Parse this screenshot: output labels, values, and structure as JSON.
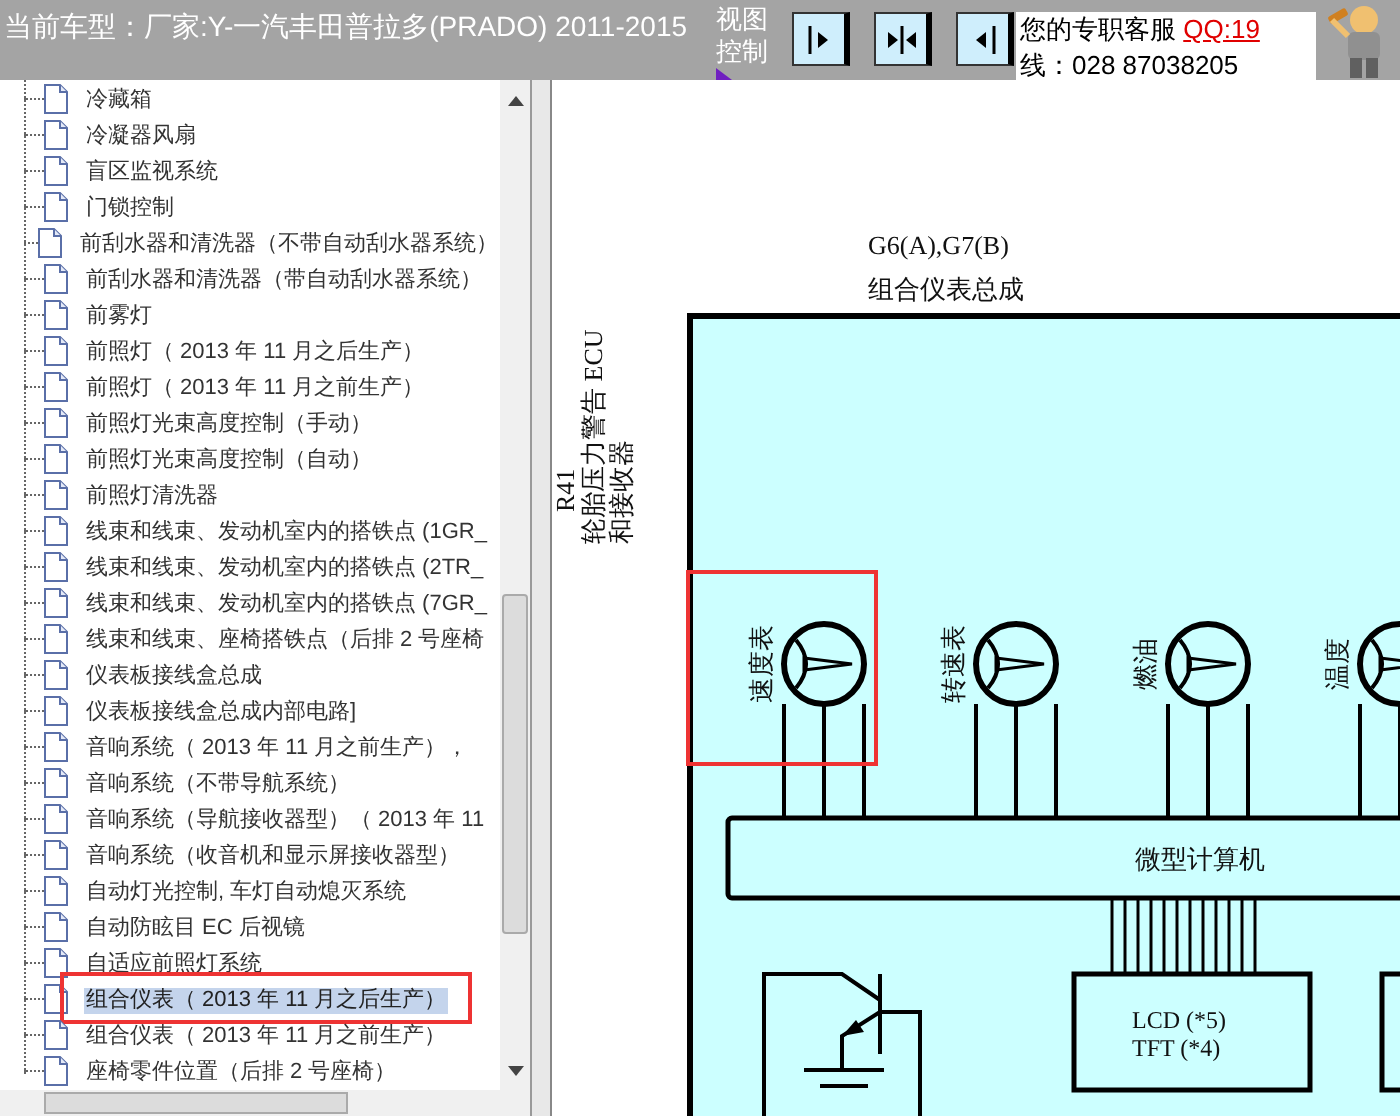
{
  "header": {
    "car_model": "当前车型：厂家:Y-一汽丰田普拉多(PRADO) 2011-2015",
    "view_control": [
      "视图",
      "控制"
    ],
    "service": {
      "label": "您的专职客服",
      "qq": "QQ:19",
      "phone": "线：028 87038205"
    }
  },
  "tree": {
    "items": [
      {
        "label": "冷藏箱",
        "selected": false,
        "annotated": false
      },
      {
        "label": "冷凝器风扇",
        "selected": false,
        "annotated": false
      },
      {
        "label": "盲区监视系统",
        "selected": false,
        "annotated": false
      },
      {
        "label": "门锁控制",
        "selected": false,
        "annotated": false
      },
      {
        "label": "前刮水器和清洗器（不带自动刮水器系统）",
        "selected": false,
        "annotated": false
      },
      {
        "label": "前刮水器和清洗器（带自动刮水器系统）",
        "selected": false,
        "annotated": false
      },
      {
        "label": "前雾灯",
        "selected": false,
        "annotated": false
      },
      {
        "label": "前照灯（ 2013 年 11 月之后生产）",
        "selected": false,
        "annotated": false
      },
      {
        "label": "前照灯（ 2013 年 11 月之前生产）",
        "selected": false,
        "annotated": false
      },
      {
        "label": "前照灯光束高度控制（手动）",
        "selected": false,
        "annotated": false
      },
      {
        "label": "前照灯光束高度控制（自动）",
        "selected": false,
        "annotated": false
      },
      {
        "label": "前照灯清洗器",
        "selected": false,
        "annotated": false
      },
      {
        "label": "线束和线束、发动机室内的搭铁点 (1GR_",
        "selected": false,
        "annotated": false
      },
      {
        "label": "线束和线束、发动机室内的搭铁点 (2TR_",
        "selected": false,
        "annotated": false
      },
      {
        "label": "线束和线束、发动机室内的搭铁点 (7GR_",
        "selected": false,
        "annotated": false
      },
      {
        "label": "线束和线束、座椅搭铁点（后排 2 号座椅",
        "selected": false,
        "annotated": false
      },
      {
        "label": "仪表板接线盒总成",
        "selected": false,
        "annotated": false
      },
      {
        "label": "仪表板接线盒总成内部电路]",
        "selected": false,
        "annotated": false
      },
      {
        "label": "音响系统（ 2013 年 11 月之前生产），",
        "selected": false,
        "annotated": false
      },
      {
        "label": "音响系统（不带导航系统）",
        "selected": false,
        "annotated": false
      },
      {
        "label": "音响系统（导航接收器型）（ 2013 年 11",
        "selected": false,
        "annotated": false
      },
      {
        "label": "音响系统（收音机和显示屏接收器型）",
        "selected": false,
        "annotated": false
      },
      {
        "label": "自动灯光控制, 车灯自动熄灭系统",
        "selected": false,
        "annotated": false
      },
      {
        "label": "自动防眩目 EC 后视镜",
        "selected": false,
        "annotated": false
      },
      {
        "label": "自适应前照灯系统",
        "selected": false,
        "annotated": false
      },
      {
        "label": "组合仪表（ 2013 年 11 月之后生产）",
        "selected": true,
        "annotated": true
      },
      {
        "label": "组合仪表（ 2013 年 11 月之前生产）",
        "selected": false,
        "annotated": false
      },
      {
        "label": "座椅零件位置（后排 2 号座椅）",
        "selected": false,
        "annotated": false
      }
    ]
  },
  "diagram": {
    "title": [
      "G6(A),G7(B)",
      "组合仪表总成"
    ],
    "side_label": [
      "R41",
      "轮胎压力警告 ECU",
      "和接收器"
    ],
    "gauges": [
      {
        "label": "速度表",
        "annotated": true
      },
      {
        "label": "转速表",
        "annotated": false
      },
      {
        "label": "燃油",
        "annotated": false
      },
      {
        "label": "温度",
        "annotated": false
      }
    ],
    "computer": "微型计算机",
    "display": [
      "LCD (*5)",
      "TFT (*4)"
    ]
  }
}
